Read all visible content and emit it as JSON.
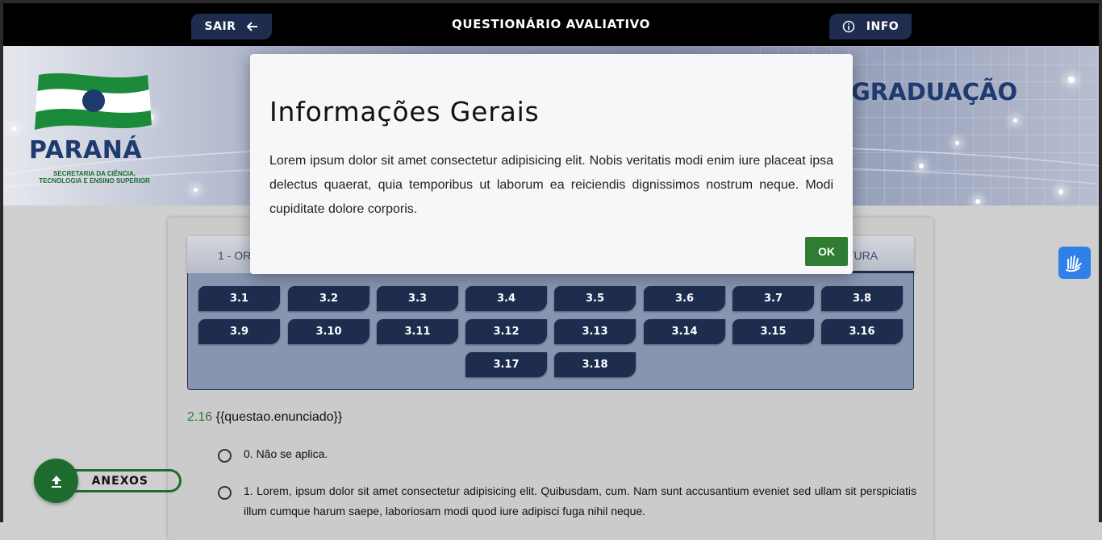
{
  "header": {
    "title": "QUESTIONÁRIO AVALIATIVO",
    "sair_label": "SAIR",
    "info_label": "INFO"
  },
  "banner": {
    "parana": "PARANÁ",
    "secretaria_line1": "SECRETARIA DA CIÊNCIA,",
    "secretaria_line2": "TECNOLOGIA E ENSINO SUPERIOR",
    "partial_heading": "GRADUAÇÃO"
  },
  "tabs": {
    "left_partial": "1 - OR",
    "right_partial": "TURA"
  },
  "question_buttons": [
    "3.1",
    "3.2",
    "3.3",
    "3.4",
    "3.5",
    "3.6",
    "3.7",
    "3.8",
    "3.9",
    "3.10",
    "3.11",
    "3.12",
    "3.13",
    "3.14",
    "3.15",
    "3.16",
    "3.17",
    "3.18"
  ],
  "question": {
    "number": "2.16",
    "text": "{{questao.enunciado}}",
    "options": [
      "0. Não se aplica.",
      "1. Lorem, ipsum dolor sit amet consectetur adipisicing elit. Quibusdam, cum. Nam sunt accusantium eveniet sed ullam sit perspiciatis illum cumque harum saepe, laboriosam modi quod iure adipisci fuga nihil neque."
    ]
  },
  "anexos": {
    "label": "ANEXOS"
  },
  "modal": {
    "title": "Informações Gerais",
    "body": "Lorem ipsum dolor sit amet consectetur adipisicing elit. Nobis veritatis modi enim iure placeat ipsa delectus quaerat, quia temporibus ut laborum ea reiciendis dignissimos nostrum neque. Modi cupiditate dolore corporis.",
    "ok_label": "OK"
  },
  "colors": {
    "navy": "#1e2d4e",
    "green": "#2e7d32",
    "panel": "#8795b1"
  }
}
